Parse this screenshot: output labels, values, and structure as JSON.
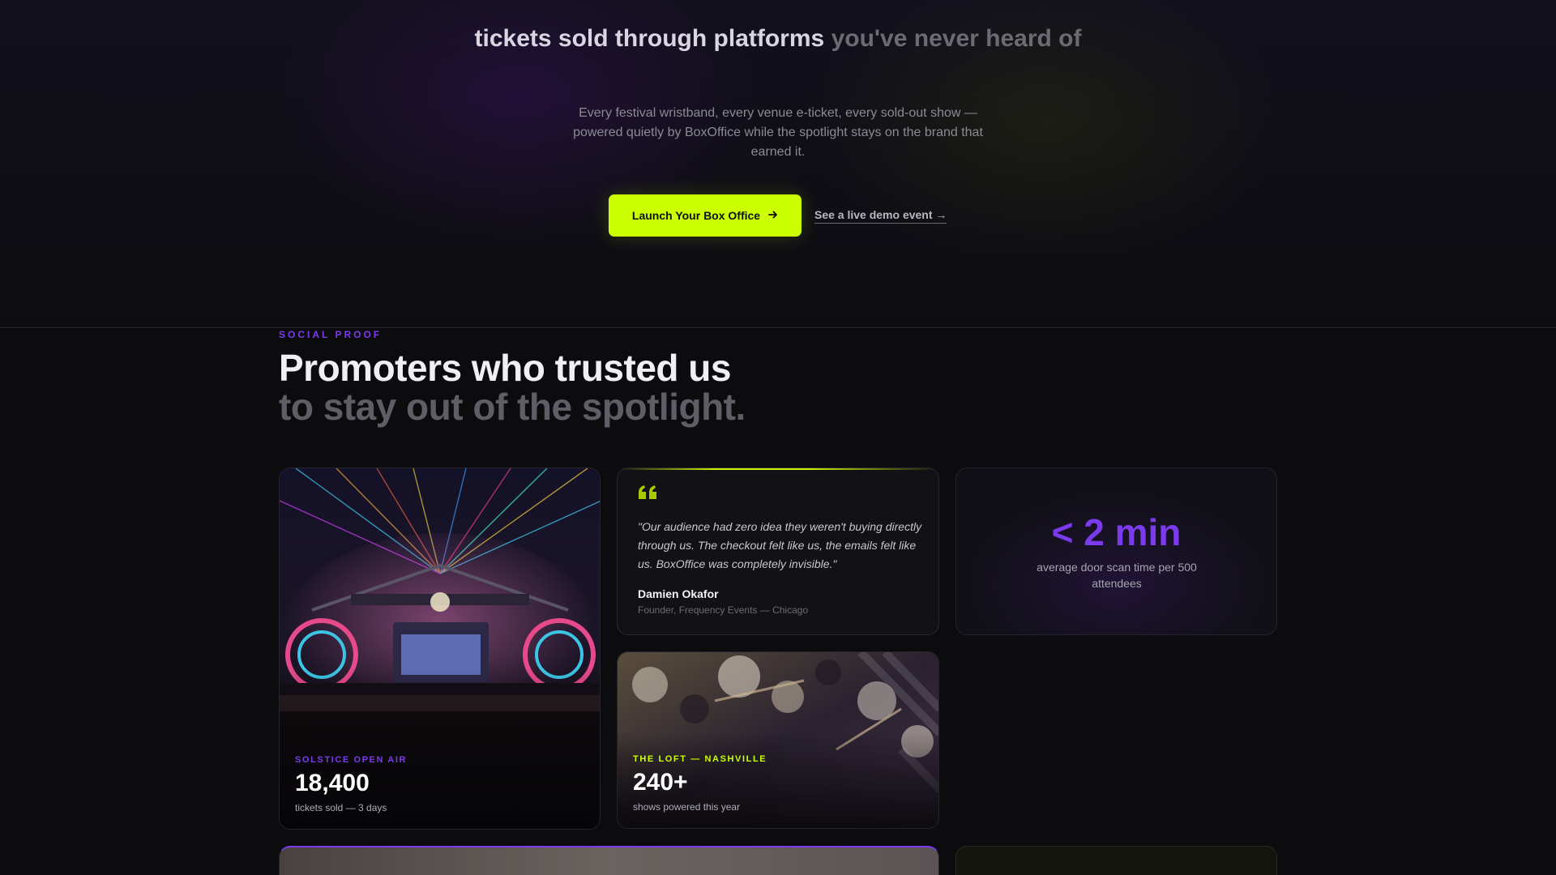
{
  "hero": {
    "headline_bright": "tickets sold through platforms",
    "headline_dim": "you've never heard of",
    "subtitle": "Every festival wristband, every venue e-ticket, every sold-out show — powered quietly by BoxOffice while the spotlight stays on the brand that earned it.",
    "primary_cta": "Launch Your Box Office",
    "primary_cta_icon": "arrow-right-icon",
    "secondary_cta": "See a live demo event →"
  },
  "social_proof": {
    "eyebrow": "SOCIAL PROOF",
    "title_line1": "Promoters who trusted us",
    "title_line2": "to stay out of the spotlight.",
    "festival_card": {
      "tag": "SOLSTICE OPEN AIR",
      "value": "18,400",
      "caption": "tickets sold — 3 days",
      "tag_color": "#7c3aed"
    },
    "quote_card": {
      "quote": "\"Our audience had zero idea they weren't buying directly through us. The checkout felt like us, the emails felt like us. BoxOffice was completely invisible.\"",
      "name": "Damien Okafor",
      "role": "Founder, Frequency Events — Chicago",
      "accent": "#c8f000"
    },
    "stat_card": {
      "value": "< 2 min",
      "label": "average door scan time per 500 attendees",
      "accent": "#7c3aed"
    },
    "band_card": {
      "tag": "THE LOFT — NASHVILLE",
      "value": "240+",
      "caption": "shows powered this year",
      "tag_color": "#ccff00"
    }
  },
  "colors": {
    "lime": "#ccff00",
    "purple": "#7c3aed",
    "background": "#0c0c0f"
  }
}
